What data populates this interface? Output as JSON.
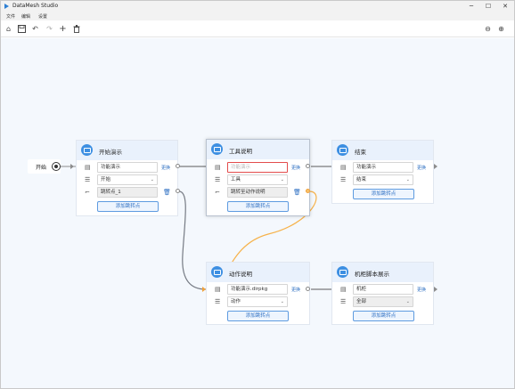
{
  "window": {
    "title": "DataMesh Studio",
    "minimize": "─",
    "maximize": "☐",
    "close": "✕"
  },
  "menu": [
    "文件",
    "编辑",
    "设置"
  ],
  "toolbar": {
    "home": "⌂",
    "save": "🖫",
    "undo": "↶",
    "redo": "↷",
    "add": "+",
    "delete": "🗑",
    "zoom_out": "⊖",
    "zoom_in": "⊕"
  },
  "start": {
    "label": "开始"
  },
  "nodes": {
    "start_demo": {
      "title": "开始演示",
      "field1": "功能演示",
      "link": "更换",
      "select": "开始",
      "jump": "跳转点_1",
      "add": "添加跳转点"
    },
    "tool_desc": {
      "title": "工具说明",
      "field1": "功能演示",
      "link": "更换",
      "select": "工具",
      "jump": "跳转至动作说明",
      "add": "添加跳转点"
    },
    "end": {
      "title": "结束",
      "field1": "功能演示",
      "link": "更换",
      "select": "结束",
      "add": "添加跳转点"
    },
    "action_desc": {
      "title": "动作说明",
      "field1": "功能演示.dirpkg",
      "link": "更换",
      "select": "动作",
      "add": "添加跳转点"
    },
    "cabinet": {
      "title": "机柜脚本展示",
      "field1": "机柜",
      "link": "更换",
      "select": "全部",
      "add": "添加跳转点"
    }
  },
  "colors": {
    "accent": "#2d6fc2",
    "error": "#e34c4c",
    "orange_wire": "#f6b24a",
    "canvas": "#f4f8fd"
  }
}
